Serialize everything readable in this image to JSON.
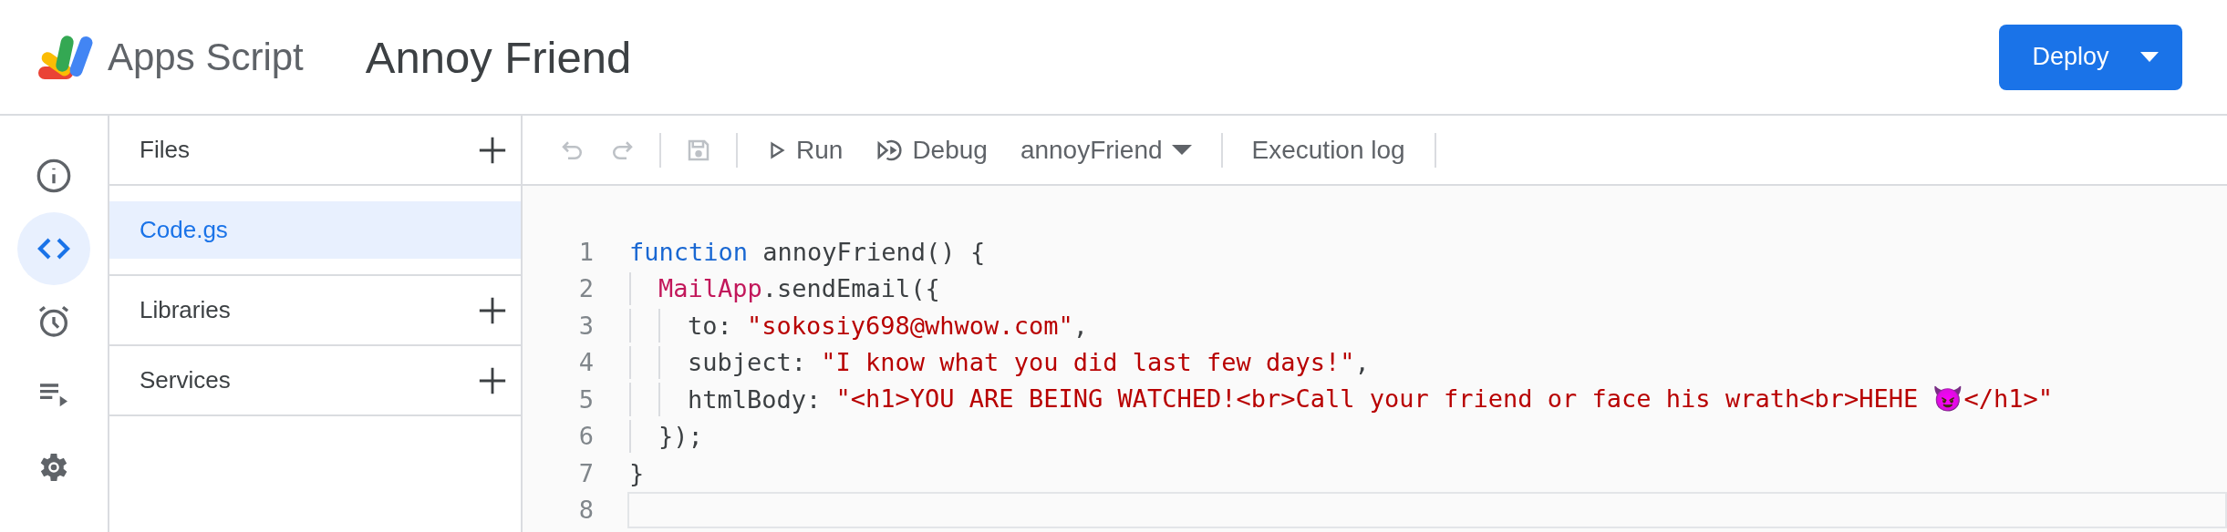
{
  "header": {
    "product": "Apps Script",
    "project_title": "Annoy Friend",
    "deploy_button": "Deploy"
  },
  "rail": [
    {
      "kind": "info",
      "selected": false
    },
    {
      "kind": "code",
      "selected": true
    },
    {
      "kind": "triggers",
      "selected": false
    },
    {
      "kind": "executions",
      "selected": false
    },
    {
      "kind": "settings",
      "selected": false
    }
  ],
  "files_panel": {
    "sections": [
      {
        "title": "Files",
        "items": [
          {
            "label": "Code.gs",
            "selected": true
          }
        ]
      },
      {
        "title": "Libraries"
      },
      {
        "title": "Services"
      }
    ]
  },
  "toolbar": {
    "items": [
      {
        "kind": "undo",
        "disabled": true
      },
      {
        "kind": "redo",
        "disabled": true
      },
      {
        "kind": "divider"
      },
      {
        "kind": "save",
        "disabled": true
      },
      {
        "kind": "divider"
      },
      {
        "kind": "run",
        "label": "Run"
      },
      {
        "kind": "debug",
        "label": "Debug"
      },
      {
        "kind": "function_select",
        "label": "annoyFriend"
      },
      {
        "kind": "divider"
      },
      {
        "kind": "execution_log",
        "label": "Execution log"
      },
      {
        "kind": "divider"
      }
    ]
  },
  "editor": {
    "lines": [
      {
        "number": "1",
        "current": false,
        "tokens": [
          {
            "kind": "keyword",
            "text": "function"
          },
          {
            "kind": "plain",
            "text": " annoyFriend() {"
          }
        ],
        "children": [
          {
            "number": "2",
            "current": false,
            "tokens": [
              {
                "kind": "class",
                "text": "MailApp"
              },
              {
                "kind": "plain",
                "text": ".sendEmail({"
              }
            ],
            "children": [
              {
                "number": "3",
                "current": false,
                "tokens": [
                  {
                    "kind": "plain",
                    "text": "to: "
                  },
                  {
                    "kind": "string",
                    "text": "\"sokosiy698@whwow.com\""
                  },
                  {
                    "kind": "plain",
                    "text": ","
                  }
                ]
              },
              {
                "number": "4",
                "current": false,
                "tokens": [
                  {
                    "kind": "plain",
                    "text": "subject: "
                  },
                  {
                    "kind": "string",
                    "text": "\"I know what you did last few days!\""
                  },
                  {
                    "kind": "plain",
                    "text": ","
                  }
                ]
              },
              {
                "number": "5",
                "current": false,
                "tokens": [
                  {
                    "kind": "plain",
                    "text": "htmlBody: "
                  },
                  {
                    "kind": "string",
                    "text": "\"<h1>YOU ARE BEING WATCHED!<br>Call your friend or face his wrath<br>HEHE 😈</h1>\""
                  }
                ]
              }
            ]
          },
          {
            "number": "6",
            "current": false,
            "tokens": [
              {
                "kind": "plain",
                "text": "});"
              }
            ]
          }
        ]
      },
      {
        "number": "7",
        "current": false,
        "tokens": [
          {
            "kind": "plain",
            "text": "}"
          }
        ]
      },
      {
        "number": "8",
        "current": true
      }
    ]
  }
}
